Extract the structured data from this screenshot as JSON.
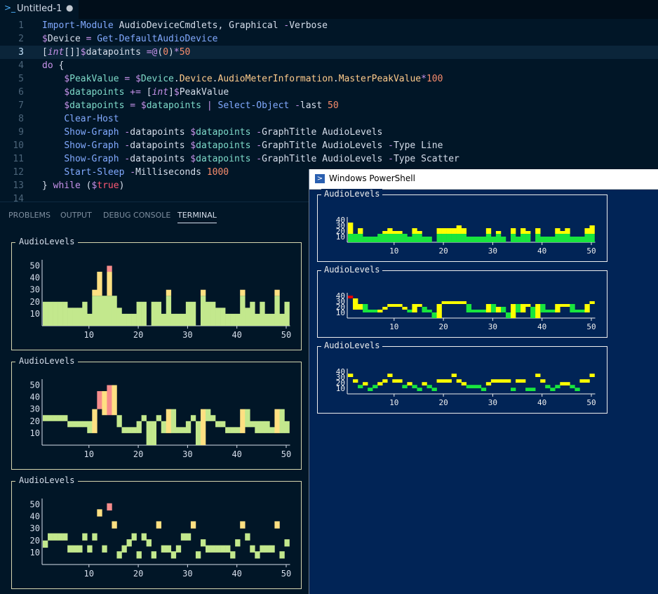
{
  "tab": {
    "icon": "powershell-icon",
    "label": "Untitled-1",
    "dirty_mark": "●"
  },
  "code_lines": [
    {
      "n": "1",
      "tokens": [
        [
          "cm",
          "Import-Module"
        ],
        [
          "tx",
          " AudioDeviceCmdlets, Graphical "
        ],
        [
          "op",
          "-"
        ],
        [
          "tx",
          "Verbose"
        ]
      ]
    },
    {
      "n": "2",
      "tokens": [
        [
          "op",
          "$"
        ],
        [
          "tx",
          "Device "
        ],
        [
          "op",
          "="
        ],
        [
          "tx",
          " "
        ],
        [
          "cm",
          "Get-DefaultAudioDevice"
        ]
      ]
    },
    {
      "n": "3",
      "tokens": [
        [
          "pn",
          "["
        ],
        [
          "ty",
          "int"
        ],
        [
          "pn",
          "[]]"
        ],
        [
          "op",
          "$"
        ],
        [
          "tx",
          "datapoints "
        ],
        [
          "op",
          "=@"
        ],
        [
          "pn",
          "("
        ],
        [
          "nm",
          "0"
        ],
        [
          "pn",
          ")"
        ],
        [
          "op",
          "*"
        ],
        [
          "nm",
          "50"
        ]
      ]
    },
    {
      "n": "4",
      "tokens": [
        [
          "kw",
          "do"
        ],
        [
          "tx",
          " {"
        ]
      ]
    },
    {
      "n": "5",
      "tokens": [
        [
          "tx",
          "    "
        ],
        [
          "op",
          "$"
        ],
        [
          "vr",
          "PeakValue"
        ],
        [
          "tx",
          " "
        ],
        [
          "op",
          "="
        ],
        [
          "tx",
          " "
        ],
        [
          "op",
          "$"
        ],
        [
          "vr",
          "Device"
        ],
        [
          "tx",
          "."
        ],
        [
          "pr",
          "Device"
        ],
        [
          "tx",
          "."
        ],
        [
          "pr",
          "AudioMeterInformation"
        ],
        [
          "tx",
          "."
        ],
        [
          "pr",
          "MasterPeakValue"
        ],
        [
          "op",
          "*"
        ],
        [
          "nm",
          "100"
        ]
      ]
    },
    {
      "n": "6",
      "tokens": [
        [
          "tx",
          "    "
        ],
        [
          "op",
          "$"
        ],
        [
          "vr",
          "datapoints"
        ],
        [
          "tx",
          " "
        ],
        [
          "op",
          "+="
        ],
        [
          "tx",
          " ["
        ],
        [
          "ty",
          "int"
        ],
        [
          "tx",
          "]"
        ],
        [
          "op",
          "$"
        ],
        [
          "tx",
          "PeakValue"
        ]
      ]
    },
    {
      "n": "7",
      "tokens": [
        [
          "tx",
          "    "
        ],
        [
          "op",
          "$"
        ],
        [
          "vr",
          "datapoints"
        ],
        [
          "tx",
          " "
        ],
        [
          "op",
          "="
        ],
        [
          "tx",
          " "
        ],
        [
          "op",
          "$"
        ],
        [
          "vr",
          "datapoints"
        ],
        [
          "tx",
          " "
        ],
        [
          "op",
          "|"
        ],
        [
          "tx",
          " "
        ],
        [
          "cm",
          "Select-Object"
        ],
        [
          "tx",
          " "
        ],
        [
          "op",
          "-"
        ],
        [
          "tx",
          "last "
        ],
        [
          "nm",
          "50"
        ]
      ]
    },
    {
      "n": "8",
      "tokens": [
        [
          "tx",
          "    "
        ],
        [
          "cm",
          "Clear-Host"
        ]
      ]
    },
    {
      "n": "9",
      "tokens": [
        [
          "tx",
          "    "
        ],
        [
          "cm",
          "Show-Graph"
        ],
        [
          "tx",
          " "
        ],
        [
          "op",
          "-"
        ],
        [
          "tx",
          "datapoints "
        ],
        [
          "op",
          "$"
        ],
        [
          "vr",
          "datapoints"
        ],
        [
          "tx",
          " "
        ],
        [
          "op",
          "-"
        ],
        [
          "tx",
          "GraphTitle AudioLevels"
        ]
      ]
    },
    {
      "n": "10",
      "tokens": [
        [
          "tx",
          "    "
        ],
        [
          "cm",
          "Show-Graph"
        ],
        [
          "tx",
          " "
        ],
        [
          "op",
          "-"
        ],
        [
          "tx",
          "datapoints "
        ],
        [
          "op",
          "$"
        ],
        [
          "vr",
          "datapoints"
        ],
        [
          "tx",
          " "
        ],
        [
          "op",
          "-"
        ],
        [
          "tx",
          "GraphTitle AudioLevels "
        ],
        [
          "op",
          "-"
        ],
        [
          "tx",
          "Type Line"
        ]
      ]
    },
    {
      "n": "11",
      "tokens": [
        [
          "tx",
          "    "
        ],
        [
          "cm",
          "Show-Graph"
        ],
        [
          "tx",
          " "
        ],
        [
          "op",
          "-"
        ],
        [
          "tx",
          "datapoints "
        ],
        [
          "op",
          "$"
        ],
        [
          "vr",
          "datapoints"
        ],
        [
          "tx",
          " "
        ],
        [
          "op",
          "-"
        ],
        [
          "tx",
          "GraphTitle AudioLevels "
        ],
        [
          "op",
          "-"
        ],
        [
          "tx",
          "Type Scatter"
        ]
      ]
    },
    {
      "n": "12",
      "tokens": [
        [
          "tx",
          "    "
        ],
        [
          "cm",
          "Start-Sleep"
        ],
        [
          "tx",
          " "
        ],
        [
          "op",
          "-"
        ],
        [
          "tx",
          "Milliseconds "
        ],
        [
          "nm",
          "1000"
        ]
      ]
    },
    {
      "n": "13",
      "tokens": [
        [
          "tx",
          "} "
        ],
        [
          "kw",
          "while"
        ],
        [
          "tx",
          " ("
        ],
        [
          "op",
          "$"
        ],
        [
          "tr",
          "true"
        ],
        [
          "tx",
          ")"
        ]
      ]
    },
    {
      "n": "14",
      "tokens": []
    }
  ],
  "panel_tabs": [
    "PROBLEMS",
    "OUTPUT",
    "DEBUG CONSOLE",
    "TERMINAL"
  ],
  "active_panel_tab": "TERMINAL",
  "ps_window": {
    "icon": "powershell-icon",
    "title": "Windows PowerShell"
  },
  "colors": {
    "low": "#c3e88d",
    "mid": "#ffe082",
    "high": "#f78c8c",
    "ps_low": "#18e53e",
    "ps_mid": "#ffff00",
    "ps_high": "#e00000"
  },
  "chart_data": [
    {
      "type": "bar",
      "title": "AudioLevels",
      "y_ticks": [
        10,
        20,
        30,
        40,
        50
      ],
      "x_ticks": [
        10,
        20,
        30,
        40,
        50
      ],
      "values": [
        20,
        20,
        20,
        20,
        20,
        15,
        15,
        15,
        20,
        10,
        30,
        45,
        25,
        50,
        25,
        15,
        10,
        10,
        10,
        20,
        20,
        0,
        20,
        20,
        10,
        30,
        10,
        10,
        10,
        20,
        20,
        0,
        30,
        20,
        20,
        15,
        15,
        10,
        10,
        10,
        30,
        15,
        20,
        10,
        20,
        10,
        10,
        30,
        10,
        20
      ]
    },
    {
      "type": "line",
      "title": "AudioLevels",
      "y_ticks": [
        10,
        20,
        30,
        40,
        50
      ],
      "x_ticks": [
        10,
        20,
        30,
        40,
        50
      ],
      "values": [
        20,
        20,
        20,
        20,
        20,
        15,
        15,
        15,
        20,
        10,
        30,
        45,
        25,
        50,
        25,
        15,
        10,
        10,
        10,
        20,
        20,
        0,
        20,
        20,
        10,
        30,
        10,
        10,
        10,
        20,
        20,
        0,
        30,
        20,
        20,
        15,
        15,
        10,
        10,
        10,
        30,
        15,
        20,
        10,
        20,
        10,
        10,
        30,
        10,
        20
      ]
    },
    {
      "type": "scatter",
      "title": "AudioLevels",
      "y_ticks": [
        10,
        20,
        30,
        40,
        50
      ],
      "x_ticks": [
        10,
        20,
        30,
        40,
        50
      ],
      "values": [
        17,
        23,
        23,
        23,
        23,
        13,
        13,
        13,
        23,
        13,
        23,
        43,
        13,
        48,
        33,
        8,
        13,
        18,
        23,
        8,
        23,
        18,
        8,
        33,
        13,
        13,
        8,
        13,
        23,
        23,
        33,
        8,
        18,
        13,
        13,
        13,
        13,
        13,
        8,
        18,
        33,
        23,
        13,
        8,
        13,
        13,
        13,
        33,
        8,
        18
      ]
    },
    {
      "type": "bar",
      "title": "AudioLevels",
      "y_ticks": [
        10,
        20,
        30,
        40
      ],
      "x_ticks": [
        10,
        20,
        30,
        40,
        50
      ],
      "values": [
        35,
        15,
        25,
        10,
        10,
        10,
        15,
        20,
        25,
        20,
        20,
        15,
        10,
        25,
        20,
        10,
        10,
        0,
        25,
        25,
        25,
        25,
        30,
        25,
        10,
        10,
        10,
        10,
        25,
        10,
        20,
        10,
        0,
        25,
        10,
        25,
        20,
        0,
        25,
        10,
        10,
        10,
        25,
        20,
        25,
        10,
        10,
        10,
        25,
        30
      ]
    },
    {
      "type": "line",
      "title": "AudioLevels",
      "y_ticks": [
        10,
        20,
        30,
        40
      ],
      "x_ticks": [
        10,
        20,
        30,
        40,
        50
      ],
      "values": [
        35,
        15,
        25,
        10,
        10,
        10,
        15,
        20,
        25,
        20,
        20,
        15,
        10,
        25,
        20,
        10,
        10,
        0,
        25,
        25,
        25,
        25,
        30,
        25,
        10,
        10,
        10,
        10,
        25,
        10,
        20,
        10,
        0,
        25,
        10,
        25,
        20,
        0,
        25,
        10,
        10,
        10,
        25,
        20,
        25,
        10,
        10,
        10,
        25,
        30
      ]
    },
    {
      "type": "scatter",
      "title": "AudioLevels",
      "y_ticks": [
        10,
        20,
        30,
        40
      ],
      "x_ticks": [
        10,
        20,
        30,
        40,
        50
      ],
      "values": [
        33,
        23,
        13,
        18,
        8,
        13,
        18,
        23,
        33,
        23,
        23,
        13,
        18,
        13,
        8,
        18,
        13,
        8,
        23,
        23,
        23,
        33,
        23,
        18,
        13,
        13,
        13,
        8,
        18,
        23,
        23,
        23,
        23,
        8,
        23,
        23,
        8,
        8,
        33,
        23,
        13,
        8,
        13,
        18,
        18,
        13,
        8,
        23,
        23,
        33
      ]
    }
  ]
}
